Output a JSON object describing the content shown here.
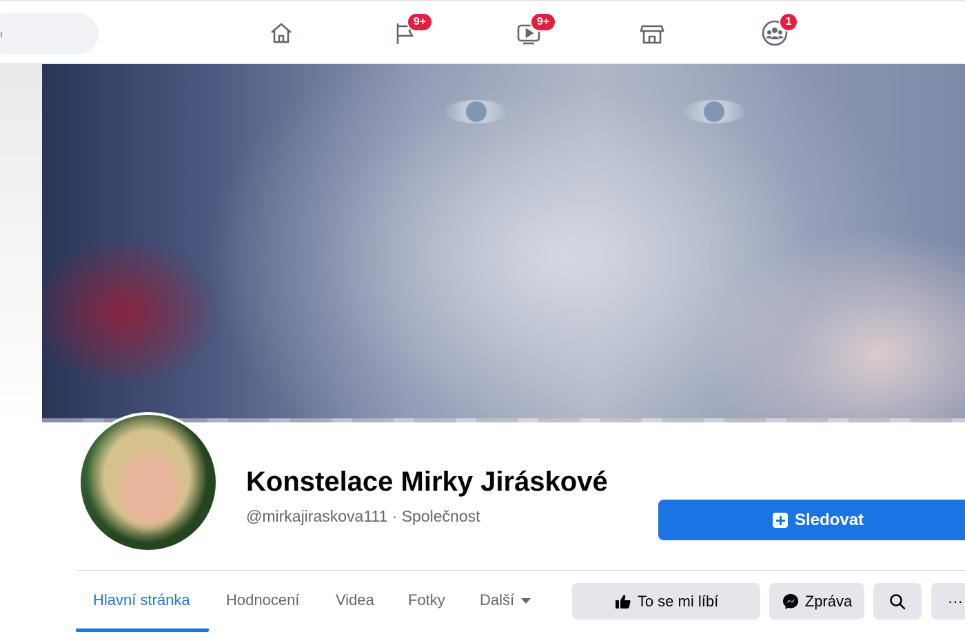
{
  "nav": {
    "search_glyph": "ı",
    "badges": {
      "flag": "9+",
      "video": "9+",
      "groups": "1"
    }
  },
  "page": {
    "name": "Konstelace Mirky Jiráskové",
    "handle": "@mirkajiraskova111 · Společnost",
    "follow_label": "Sledovat"
  },
  "tabs": [
    {
      "label": "Hlavní stránka",
      "active": true
    },
    {
      "label": "Hodnocení"
    },
    {
      "label": "Videa"
    },
    {
      "label": "Fotky"
    },
    {
      "label": "Další"
    }
  ],
  "actions": {
    "like_label": "To se mi líbí",
    "message_label": "Zpráva",
    "more_label": "···"
  },
  "colors": {
    "accent": "#1b74e4",
    "badge": "#e41e3f"
  }
}
